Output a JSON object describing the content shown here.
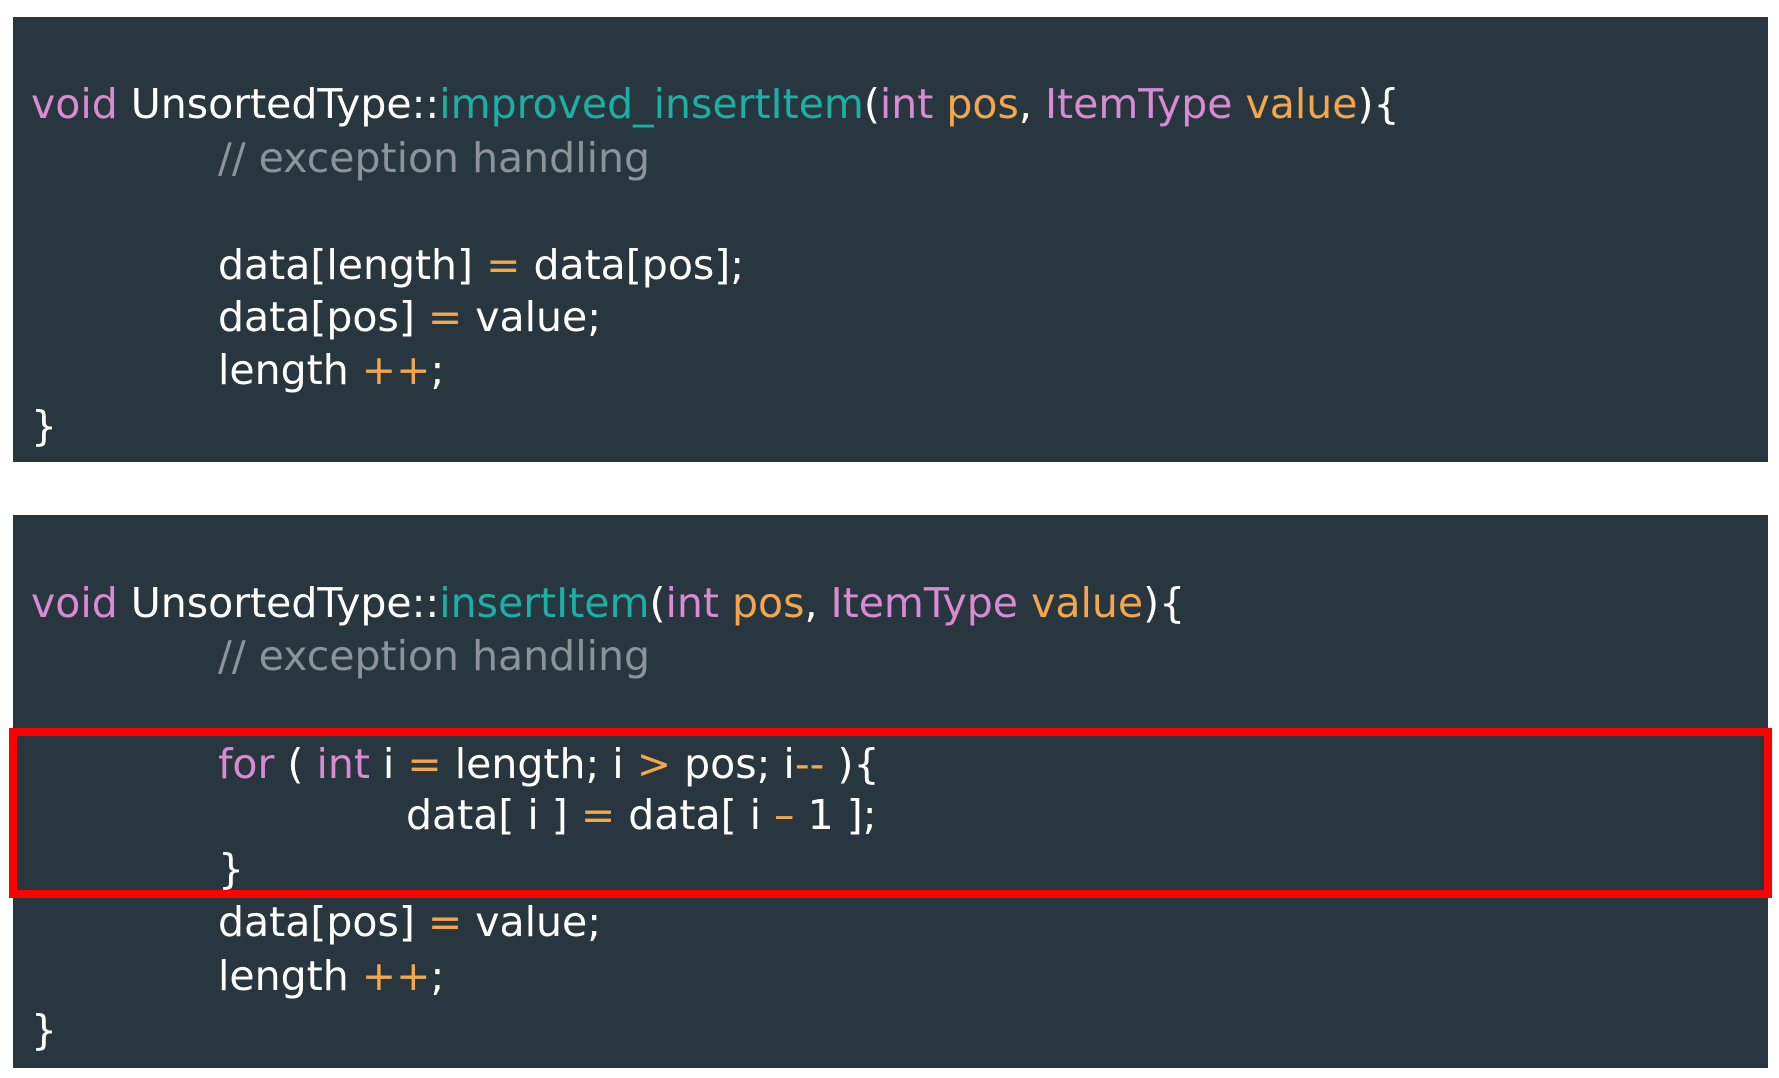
{
  "colors": {
    "background": "#283640",
    "keyword": "#d98ad0",
    "function": "#1cb0a4",
    "parameter": "#f4a64a",
    "operator": "#f4a64a",
    "comment": "#8b949b",
    "text": "#ffffff",
    "highlight": "#ff0000"
  },
  "blocks": [
    {
      "lines": [
        {
          "tokens": [
            {
              "t": "void",
              "k": "kw"
            },
            {
              "t": " UnsortedType::",
              "k": "id"
            },
            {
              "t": "improved_insertItem",
              "k": "fn"
            },
            {
              "t": "(",
              "k": "punct"
            },
            {
              "t": "int",
              "k": "kw"
            },
            {
              "t": " ",
              "k": "punct"
            },
            {
              "t": "pos",
              "k": "param"
            },
            {
              "t": ", ",
              "k": "punct"
            },
            {
              "t": "ItemType",
              "k": "kw"
            },
            {
              "t": " ",
              "k": "punct"
            },
            {
              "t": "value",
              "k": "param"
            },
            {
              "t": "){",
              "k": "punct"
            }
          ]
        },
        {
          "tokens": [
            {
              "t": "// exception handling",
              "k": "comment"
            }
          ]
        },
        {
          "tokens": [
            {
              "t": "data[length] ",
              "k": "id"
            },
            {
              "t": "=",
              "k": "op"
            },
            {
              "t": " data[pos];",
              "k": "id"
            }
          ]
        },
        {
          "tokens": [
            {
              "t": "data[pos] ",
              "k": "id"
            },
            {
              "t": "=",
              "k": "op"
            },
            {
              "t": " value;",
              "k": "id"
            }
          ]
        },
        {
          "tokens": [
            {
              "t": "length ",
              "k": "id"
            },
            {
              "t": "++",
              "k": "op"
            },
            {
              "t": ";",
              "k": "id"
            }
          ]
        },
        {
          "tokens": [
            {
              "t": "}",
              "k": "punct"
            }
          ]
        }
      ]
    },
    {
      "lines": [
        {
          "tokens": [
            {
              "t": "void",
              "k": "kw"
            },
            {
              "t": " UnsortedType::",
              "k": "id"
            },
            {
              "t": "insertItem",
              "k": "fn"
            },
            {
              "t": "(",
              "k": "punct"
            },
            {
              "t": "int",
              "k": "kw"
            },
            {
              "t": " ",
              "k": "punct"
            },
            {
              "t": "pos",
              "k": "param"
            },
            {
              "t": ", ",
              "k": "punct"
            },
            {
              "t": "ItemType",
              "k": "kw"
            },
            {
              "t": " ",
              "k": "punct"
            },
            {
              "t": "value",
              "k": "param"
            },
            {
              "t": "){",
              "k": "punct"
            }
          ]
        },
        {
          "tokens": [
            {
              "t": "// exception handling",
              "k": "comment"
            }
          ]
        },
        {
          "tokens": [
            {
              "t": "for",
              "k": "kw"
            },
            {
              "t": " ( ",
              "k": "punct"
            },
            {
              "t": "int",
              "k": "kw"
            },
            {
              "t": " i ",
              "k": "id"
            },
            {
              "t": "=",
              "k": "op"
            },
            {
              "t": " length; i ",
              "k": "id"
            },
            {
              "t": ">",
              "k": "op"
            },
            {
              "t": " pos; i",
              "k": "id"
            },
            {
              "t": "--",
              "k": "op"
            },
            {
              "t": " ){",
              "k": "punct"
            }
          ]
        },
        {
          "tokens": [
            {
              "t": "data[ i ] ",
              "k": "id"
            },
            {
              "t": "=",
              "k": "op"
            },
            {
              "t": " data[ i ",
              "k": "id"
            },
            {
              "t": "–",
              "k": "op"
            },
            {
              "t": " 1 ];",
              "k": "id"
            }
          ]
        },
        {
          "tokens": [
            {
              "t": "}",
              "k": "punct"
            }
          ]
        },
        {
          "tokens": [
            {
              "t": "data[pos] ",
              "k": "id"
            },
            {
              "t": "=",
              "k": "op"
            },
            {
              "t": " value;",
              "k": "id"
            }
          ]
        },
        {
          "tokens": [
            {
              "t": "length ",
              "k": "id"
            },
            {
              "t": "++",
              "k": "op"
            },
            {
              "t": ";",
              "k": "id"
            }
          ]
        },
        {
          "tokens": [
            {
              "t": "}",
              "k": "punct"
            }
          ]
        }
      ]
    }
  ]
}
